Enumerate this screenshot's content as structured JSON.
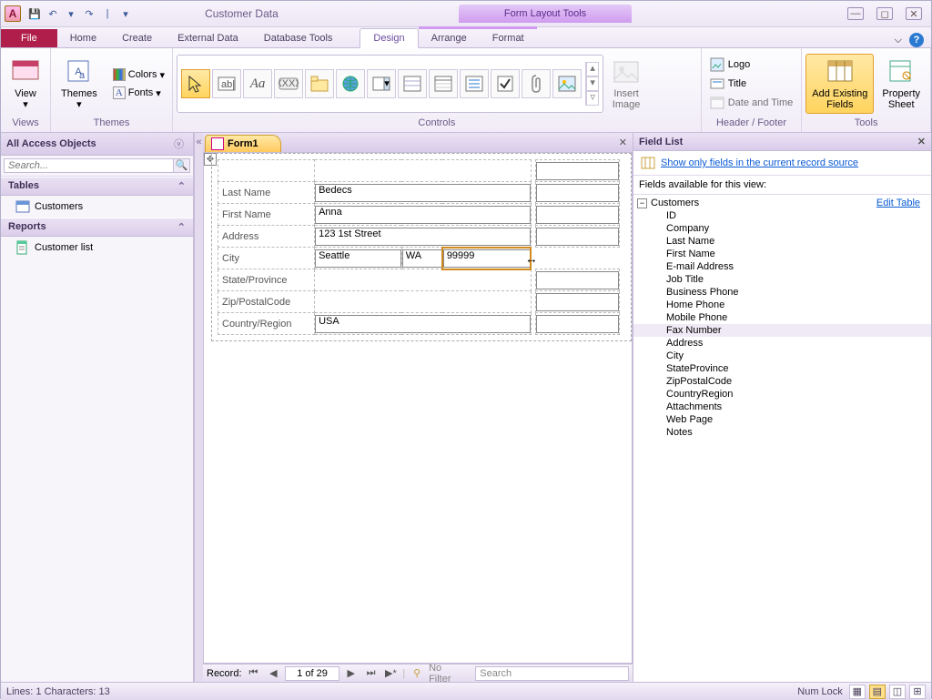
{
  "title": "Customer Data",
  "context_tools": "Form Layout Tools",
  "tabs": {
    "file": "File",
    "items": [
      "Home",
      "Create",
      "External Data",
      "Database Tools"
    ],
    "ctx": [
      "Design",
      "Arrange",
      "Format"
    ],
    "active": "Design"
  },
  "ribbon": {
    "views": {
      "label": "Views",
      "view": "View"
    },
    "themes": {
      "label": "Themes",
      "themes": "Themes",
      "colors": "Colors",
      "fonts": "Fonts"
    },
    "controls": {
      "label": "Controls",
      "insert_image": "Insert\nImage"
    },
    "header_footer": {
      "label": "Header / Footer",
      "logo": "Logo",
      "title": "Title",
      "date": "Date and Time"
    },
    "tools": {
      "label": "Tools",
      "add_existing": "Add Existing\nFields",
      "property": "Property\nSheet"
    }
  },
  "nav": {
    "header": "All Access Objects",
    "search_placeholder": "Search...",
    "sections": [
      {
        "title": "Tables",
        "items": [
          "Customers"
        ]
      },
      {
        "title": "Reports",
        "items": [
          "Customer list"
        ]
      }
    ]
  },
  "doc_tab": "Form1",
  "form": {
    "rows": [
      {
        "label": "Last Name",
        "value": "Bedecs"
      },
      {
        "label": "First Name",
        "value": "Anna"
      },
      {
        "label": "Address",
        "value": "123 1st Street"
      },
      {
        "label": "City",
        "value": "Seattle",
        "state": "WA",
        "zip": "99999"
      },
      {
        "label": "State/Province",
        "value": ""
      },
      {
        "label": "Zip/PostalCode",
        "value": ""
      },
      {
        "label": "Country/Region",
        "value": "USA"
      }
    ],
    "col2_blank": ""
  },
  "record_nav": {
    "label": "Record:",
    "position": "1 of 29",
    "filter": "No Filter",
    "search": "Search"
  },
  "field_list": {
    "title": "Field List",
    "show_only": "Show only fields in the current record source",
    "available": "Fields available for this view:",
    "table": "Customers",
    "edit": "Edit Table",
    "fields": [
      "ID",
      "Company",
      "Last Name",
      "First Name",
      "E-mail Address",
      "Job Title",
      "Business Phone",
      "Home Phone",
      "Mobile Phone",
      "Fax Number",
      "Address",
      "City",
      "StateProvince",
      "ZipPostalCode",
      "CountryRegion",
      "Attachments",
      "Web Page",
      "Notes"
    ],
    "hover": "Fax Number"
  },
  "status": {
    "left": "Lines: 1  Characters: 13",
    "numlock": "Num Lock"
  },
  "glyphs": {
    "save": "💾",
    "undo": "↶",
    "redo": "↷",
    "sep": "|",
    "dd": "▾",
    "min": "—",
    "max": "◻",
    "close": "✕",
    "caret": "⌵",
    "chev_l": "«",
    "chev_r": "»",
    "first": "⏮",
    "prev": "◀",
    "next": "▶",
    "last": "⏭",
    "new": "▶*",
    "filter": "⚲",
    "plus_minus": "⊟",
    "resize": "↔",
    "move": "✥"
  }
}
